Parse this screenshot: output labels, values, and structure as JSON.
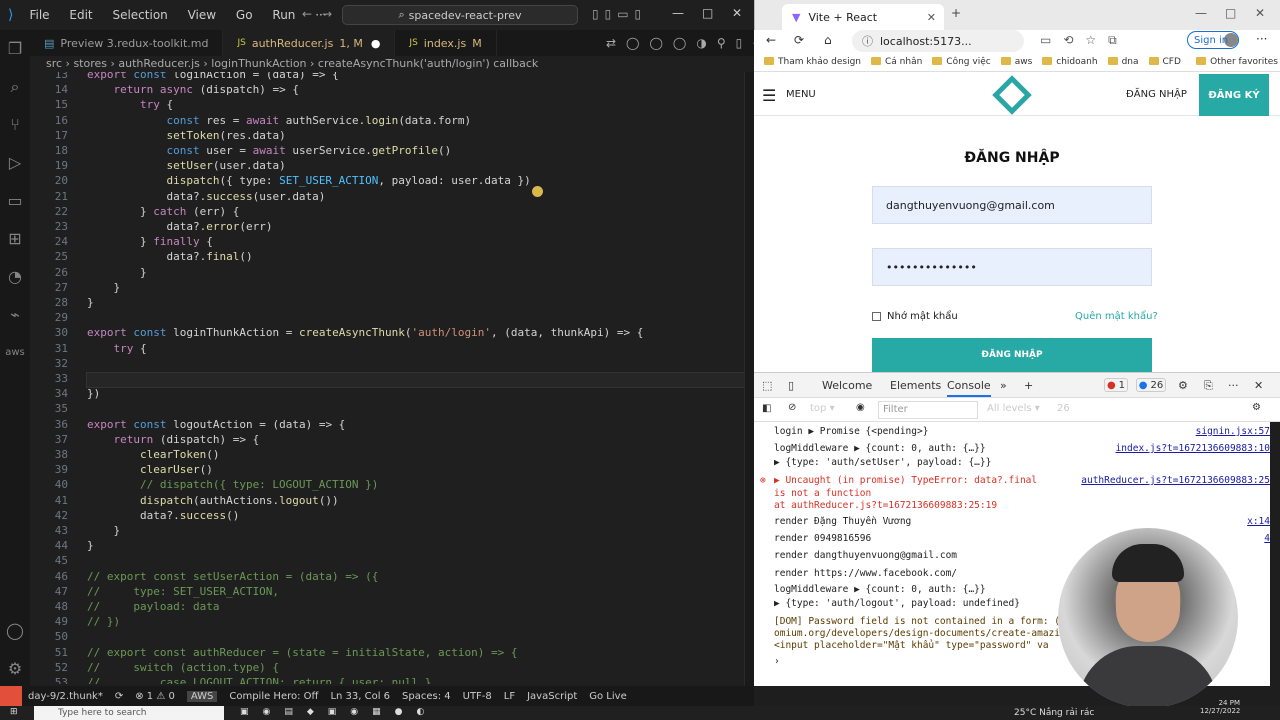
{
  "vscode": {
    "menu": [
      "File",
      "Edit",
      "Selection",
      "View",
      "Go",
      "Run",
      "···"
    ],
    "search_label": "spacedev-react-prev",
    "tabs": [
      {
        "label": "Preview 3.redux-toolkit.md",
        "mark": ""
      },
      {
        "label": "authReducer.js",
        "mark": "1, M"
      },
      {
        "label": "index.js",
        "mark": "M"
      }
    ],
    "breadcrumb": "src › stores › authReducer.js › loginThunkAction › createAsyncThunk('auth/login') callback",
    "code_lines": [
      {
        "n": "13",
        "t": "export const loginAction = (data) => {"
      },
      {
        "n": "14",
        "t": "    return async (dispatch) => {"
      },
      {
        "n": "15",
        "t": "        try {"
      },
      {
        "n": "16",
        "t": "            const res = await authService.login(data.form)"
      },
      {
        "n": "17",
        "t": "            setToken(res.data)"
      },
      {
        "n": "18",
        "t": "            const user = await userService.getProfile()"
      },
      {
        "n": "19",
        "t": "            setUser(user.data)"
      },
      {
        "n": "20",
        "t": "            dispatch({ type: SET_USER_ACTION, payload: user.data })"
      },
      {
        "n": "21",
        "t": "            data?.success(user.data)"
      },
      {
        "n": "22",
        "t": "        } catch (err) {"
      },
      {
        "n": "23",
        "t": "            data?.error(err)"
      },
      {
        "n": "24",
        "t": "        } finally {"
      },
      {
        "n": "25",
        "t": "            data?.final()"
      },
      {
        "n": "26",
        "t": "        }"
      },
      {
        "n": "27",
        "t": "    }"
      },
      {
        "n": "28",
        "t": "}"
      },
      {
        "n": "29",
        "t": ""
      },
      {
        "n": "30",
        "t": "export const loginThunkAction = createAsyncThunk('auth/login', (data, thunkApi) => {"
      },
      {
        "n": "31",
        "t": "    try {"
      },
      {
        "n": "32",
        "t": ""
      },
      {
        "n": "33",
        "t": "    }"
      },
      {
        "n": "34",
        "t": "})"
      },
      {
        "n": "35",
        "t": ""
      },
      {
        "n": "36",
        "t": "export const logoutAction = (data) => {"
      },
      {
        "n": "37",
        "t": "    return (dispatch) => {"
      },
      {
        "n": "38",
        "t": "        clearToken()"
      },
      {
        "n": "39",
        "t": "        clearUser()"
      },
      {
        "n": "40",
        "t": "        // dispatch({ type: LOGOUT_ACTION })"
      },
      {
        "n": "41",
        "t": "        dispatch(authActions.logout())"
      },
      {
        "n": "42",
        "t": "        data?.success()"
      },
      {
        "n": "43",
        "t": "    }"
      },
      {
        "n": "44",
        "t": "}"
      },
      {
        "n": "45",
        "t": ""
      },
      {
        "n": "46",
        "t": "// export const setUserAction = (data) => ({"
      },
      {
        "n": "47",
        "t": "//     type: SET_USER_ACTION,"
      },
      {
        "n": "48",
        "t": "//     payload: data"
      },
      {
        "n": "49",
        "t": "// })"
      },
      {
        "n": "50",
        "t": ""
      },
      {
        "n": "51",
        "t": "// export const authReducer = (state = initialState, action) => {"
      },
      {
        "n": "52",
        "t": "//     switch (action.type) {"
      },
      {
        "n": "53",
        "t": "//         case LOGOUT_ACTION: return { user: null }"
      }
    ],
    "status": {
      "branch": "day-9/2.thunk*",
      "problems": "⊗ 1 ⚠ 0",
      "aws": "AWS",
      "compile_hero": "Compile Hero: Off",
      "position": "Ln 33, Col 6",
      "spaces": "Spaces: 4",
      "encoding": "UTF-8",
      "eol": "LF",
      "language": "JavaScript",
      "go_live": "Go Live"
    }
  },
  "browser": {
    "tab_title": "Vite + React",
    "url": "localhost:5173...",
    "signin": "Sign in",
    "bookmarks": [
      "Tham khảo design",
      "Cá nhân",
      "Công việc",
      "aws",
      "chidoanh",
      "dna",
      "CFD",
      "Other favorites"
    ],
    "page": {
      "menu": "MENU",
      "login_link": "ĐĂNG NHẬP",
      "register_button": "ĐĂNG KÝ",
      "title": "ĐĂNG NHẬP",
      "email_value": "dangthuyenvuong@gmail.com",
      "password_value": "••••••••••••••",
      "remember": "Nhớ mật khẩu",
      "forgot": "Quên mật khẩu?",
      "submit": "ĐĂNG NHẬP"
    },
    "accent_color": "#27a9a5"
  },
  "devtools": {
    "tabs": [
      "Welcome",
      "Elements",
      "Console"
    ],
    "error_count": "1",
    "message_count": "26",
    "context": "top",
    "filter_placeholder": "Filter",
    "levels": "All levels",
    "levels_count": "26",
    "logs": [
      {
        "text": "login  ▶ Promise {<pending>}",
        "src": "signin.jsx:57"
      },
      {
        "text": "logMiddleware  ▶ {count: 0, auth: {…}}",
        "src": "index.js?t=1672136609883:10"
      },
      {
        "text": "  ▶ {type: 'auth/setUser', payload: {…}}",
        "src": ""
      },
      {
        "text": "▶ Uncaught (in promise) TypeError: data?.final",
        "src": "authReducer.js?t=1672136609883:25"
      },
      {
        "text": "is not a function",
        "src": ""
      },
      {
        "text": "    at authReducer.js?t=1672136609883:25:19",
        "src": ""
      },
      {
        "text": "render Đặng Thuyền Vương",
        "src": "x:14"
      },
      {
        "text": "render 0949816596",
        "src": "4"
      },
      {
        "text": "render dangthuyenvuong@gmail.com",
        "src": ""
      },
      {
        "text": "render https://www.facebook.com/",
        "src": ""
      },
      {
        "text": "logMiddleware  ▶ {count: 0, auth: {…}}",
        "src": ""
      },
      {
        "text": "  ▶ {type: 'auth/logout', payload: undefined}",
        "src": ""
      },
      {
        "text": "[DOM] Password field is not contained in a form: (M",
        "src": ""
      },
      {
        "text": "omium.org/developers/design-documents/create-amazin",
        "src": ""
      },
      {
        "text": "   <input placeholder=\"Mật khẩu\" type=\"password\" va",
        "src": ""
      },
      {
        "text": "›",
        "src": ""
      }
    ]
  },
  "taskbar": {
    "search": "Type here to search",
    "weather": "25°C  Nắng rải rác",
    "time": "24 PM",
    "date": "12/27/2022"
  }
}
